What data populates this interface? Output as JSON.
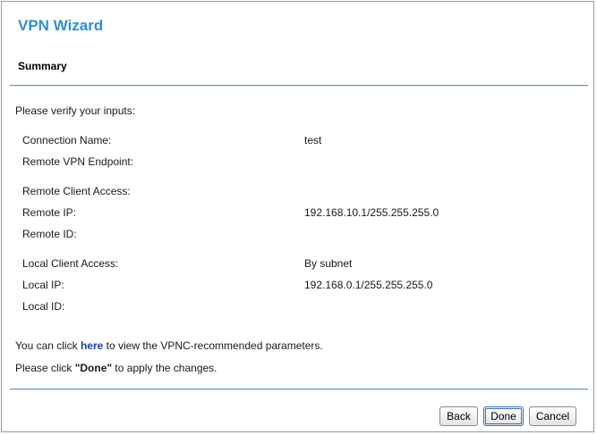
{
  "wizard": {
    "title": "VPN Wizard",
    "section": "Summary",
    "intro": "Please verify your inputs:"
  },
  "fields": [
    {
      "label": "Connection Name:",
      "value": "test"
    },
    {
      "label": "Remote VPN Endpoint:",
      "value": ""
    },
    {
      "label": "Remote Client Access:",
      "value": ""
    },
    {
      "label": "Remote IP:",
      "value": "192.168.10.1/255.255.255.0"
    },
    {
      "label": "Remote ID:",
      "value": ""
    },
    {
      "label": "Local Client Access:",
      "value": "By subnet"
    },
    {
      "label": "Local IP:",
      "value": "192.168.0.1/255.255.255.0"
    },
    {
      "label": "Local ID:",
      "value": ""
    }
  ],
  "footer": {
    "vpnc_prefix": "You can click ",
    "vpnc_link": "here",
    "vpnc_suffix": " to view the VPNC-recommended parameters.",
    "apply_prefix": "Please click ",
    "apply_strong": "\"Done\"",
    "apply_suffix": " to apply the changes."
  },
  "buttons": {
    "back": "Back",
    "done": "Done",
    "cancel": "Cancel"
  },
  "colors": {
    "title": "#2f8fd0",
    "rule": "#5a9ec6",
    "link": "#1a3fa8"
  }
}
